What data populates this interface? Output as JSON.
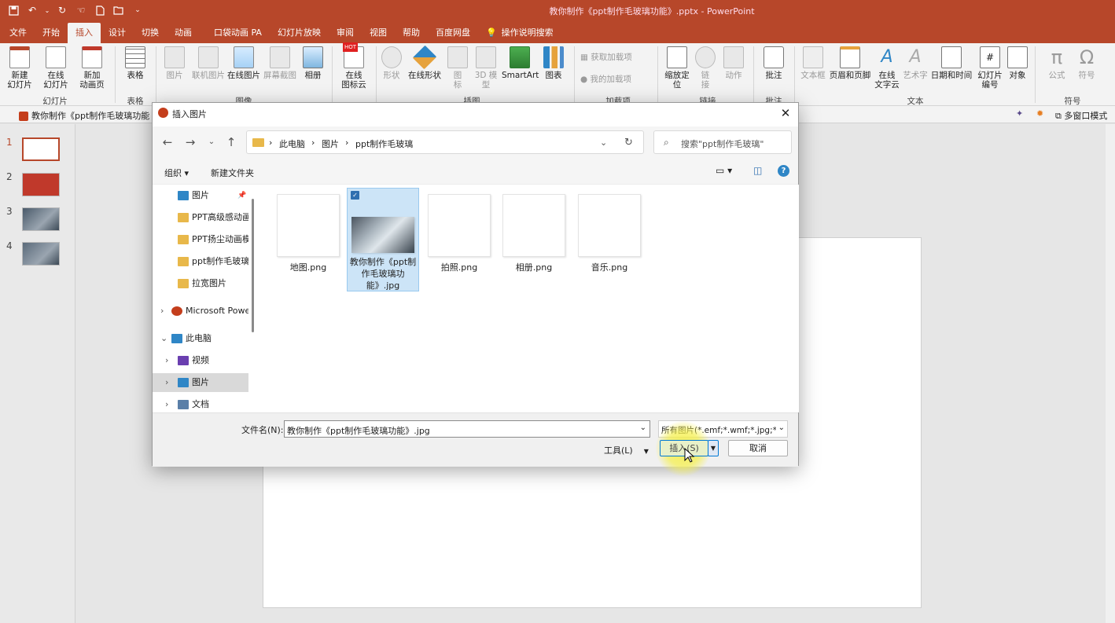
{
  "titlebar": {
    "title": "教你制作《ppt制作毛玻璃功能》.pptx  -  PowerPoint",
    "qat_icons": [
      "save-icon",
      "undo-icon",
      "redo-icon",
      "touch-icon",
      "new-doc-icon",
      "open-icon",
      "customize-icon"
    ]
  },
  "tabs": [
    "文件",
    "开始",
    "插入",
    "设计",
    "切换",
    "动画",
    "口袋动画 PA",
    "幻灯片放映",
    "审阅",
    "视图",
    "帮助",
    "百度网盘",
    "操作说明搜索"
  ],
  "active_tab": "插入",
  "ribbon": {
    "new_slide": "新建\n幻灯片",
    "online_slide": "在线\n幻灯片",
    "new_anim_page": "新加\n动画页",
    "group_slides": "幻灯片",
    "table": "表格",
    "group_table": "表格",
    "picture": "图片",
    "online_picture": "联机图片",
    "online_picture2": "在线图片",
    "screenshot": "屏幕截图",
    "album": "相册",
    "group_images": "图像",
    "online_icons": "在线\n图标云",
    "hot": "HOT",
    "shapes": "形状",
    "online_shapes": "在线形状",
    "icons": "图\n标",
    "model3d": "3D 模\n型",
    "smartart": "SmartArt",
    "chart": "图表",
    "group_illustrations": "插图",
    "get_addins": "获取加载项",
    "my_addins": "我的加载项",
    "group_addins": "加载项",
    "zoom": "缩放定\n位",
    "link": "链\n接",
    "action": "动作",
    "group_links": "链接",
    "comment": "批注",
    "group_comments": "批注",
    "textbox": "文本框",
    "header_footer": "页眉和页脚",
    "online_text": "在线\n文字云",
    "wordart": "艺术字",
    "datetime": "日期和时间",
    "slide_number": "幻灯片\n编号",
    "object": "对象",
    "group_text": "文本",
    "equation": "公式",
    "symbol": "符号",
    "group_symbols": "符号"
  },
  "tabstrip": {
    "doc_tab": "教你制作《ppt制作毛玻璃功能",
    "multi_window": "多窗口模式"
  },
  "slides": [
    {
      "num": "1"
    },
    {
      "num": "2"
    },
    {
      "num": "3"
    },
    {
      "num": "4"
    }
  ],
  "dialog": {
    "title": "插入图片",
    "breadcrumb": [
      "此电脑",
      "图片",
      "ppt制作毛玻璃"
    ],
    "search_placeholder": "搜索\"ppt制作毛玻璃\"",
    "organize": "组织 ▾",
    "new_folder": "新建文件夹",
    "tree": [
      {
        "label": "图片",
        "icon": "pictures-icon",
        "indent": 1,
        "pinned": true
      },
      {
        "label": "PPT高级感动画",
        "icon": "folder-icon",
        "indent": 1
      },
      {
        "label": "PPT扬尘动画模",
        "icon": "folder-icon",
        "indent": 1
      },
      {
        "label": "ppt制作毛玻璃",
        "icon": "folder-icon",
        "indent": 1
      },
      {
        "label": "拉宽图片",
        "icon": "folder-icon",
        "indent": 1
      },
      {
        "label": "Microsoft Powe",
        "icon": "powerpoint-icon",
        "indent": 0,
        "chevron": "›"
      },
      {
        "label": "此电脑",
        "icon": "computer-icon",
        "indent": 0,
        "chevron": "⌄"
      },
      {
        "label": "视频",
        "icon": "video-icon",
        "indent": 1,
        "chevron": "›"
      },
      {
        "label": "图片",
        "icon": "pictures-icon",
        "indent": 1,
        "chevron": "›",
        "selected": true
      },
      {
        "label": "文档",
        "icon": "document-icon",
        "indent": 1,
        "chevron": "›"
      }
    ],
    "files": [
      {
        "name": "地图.png",
        "selected": false
      },
      {
        "name": "教你制作《ppt制作毛玻璃功能》.jpg",
        "selected": true
      },
      {
        "name": "拍照.png",
        "selected": false
      },
      {
        "name": "相册.png",
        "selected": false
      },
      {
        "name": "音乐.png",
        "selected": false
      }
    ],
    "filename_label": "文件名(N):",
    "filename_value": "教你制作《ppt制作毛玻璃功能》.jpg",
    "filetype": "所有图片(*.emf;*.wmf;*.jpg;*.jp",
    "tools": "工具(L)",
    "insert": "插入(S)",
    "cancel": "取消"
  },
  "colors": {
    "accent": "#b7472a",
    "selection": "#cce4f7",
    "cursor_highlight": "#f5f04a"
  }
}
